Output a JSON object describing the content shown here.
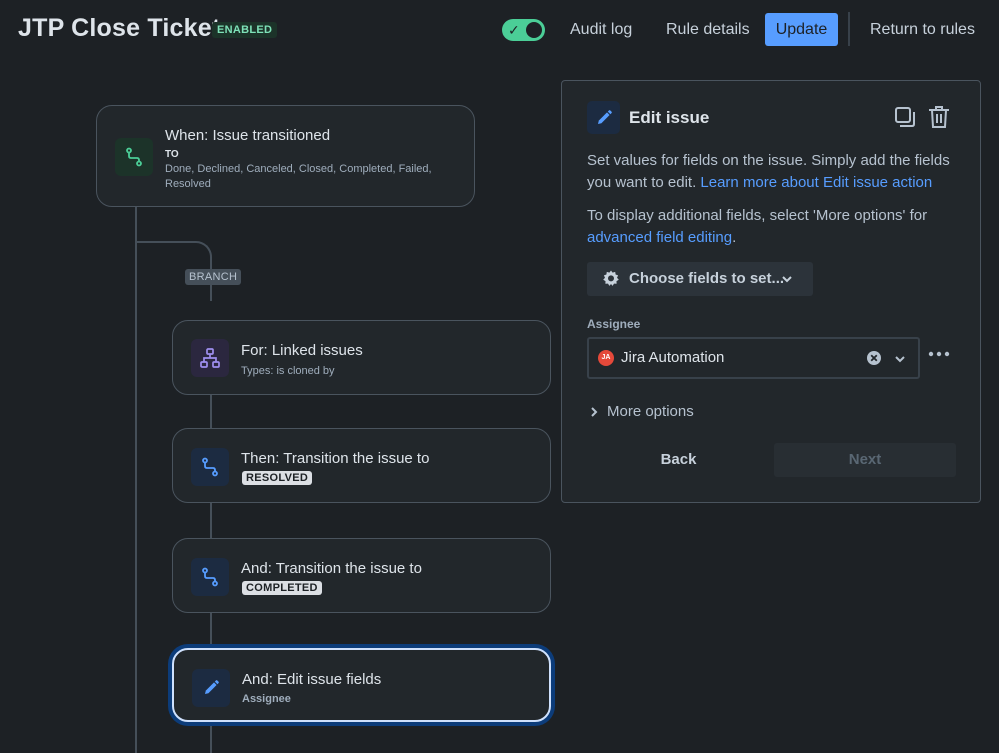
{
  "header": {
    "rule_title": "JTP Close Ticket",
    "status": "ENABLED",
    "toggle_checked": true,
    "audit_log": "Audit log",
    "rule_details": "Rule details",
    "update": "Update",
    "return_to_rules": "Return to rules"
  },
  "flow": {
    "trigger": {
      "title": "When: Issue transitioned",
      "to_label": "TO",
      "statuses": "Done, Declined, Canceled, Closed, Completed, Failed, Resolved",
      "icon": "transition-icon"
    },
    "branch_label": "BRANCH",
    "linked": {
      "title": "For: Linked issues",
      "sub": "Types: is cloned by",
      "icon": "hierarchy-icon"
    },
    "then_transition": {
      "title": "Then: Transition the issue to",
      "status": "RESOLVED",
      "icon": "transition-icon"
    },
    "and_transition": {
      "title": "And: Transition the issue to",
      "status": "COMPLETED",
      "icon": "transition-icon"
    },
    "and_edit": {
      "title": "And: Edit issue fields",
      "sub": "Assignee",
      "icon": "pencil-icon"
    }
  },
  "panel": {
    "title": "Edit issue",
    "desc1_text": "Set values for fields on the issue. Simply add the fields you want to edit.",
    "desc1_link": "Learn more about Edit issue action",
    "desc2_text": "To display additional fields, select 'More options' for",
    "desc2_link": "advanced field editing",
    "desc2_end": ".",
    "choose_fields": "Choose fields to set...",
    "field_label": "Assignee",
    "assignee_initials": "JA",
    "assignee_value": "Jira Automation",
    "more_options": "More options",
    "back": "Back",
    "next": "Next"
  },
  "colors": {
    "background": "#1d2125",
    "card": "#22272b",
    "accent_blue": "#579dff",
    "toggle_green": "#4bce97",
    "selected_outline": "#0c3c7a"
  }
}
